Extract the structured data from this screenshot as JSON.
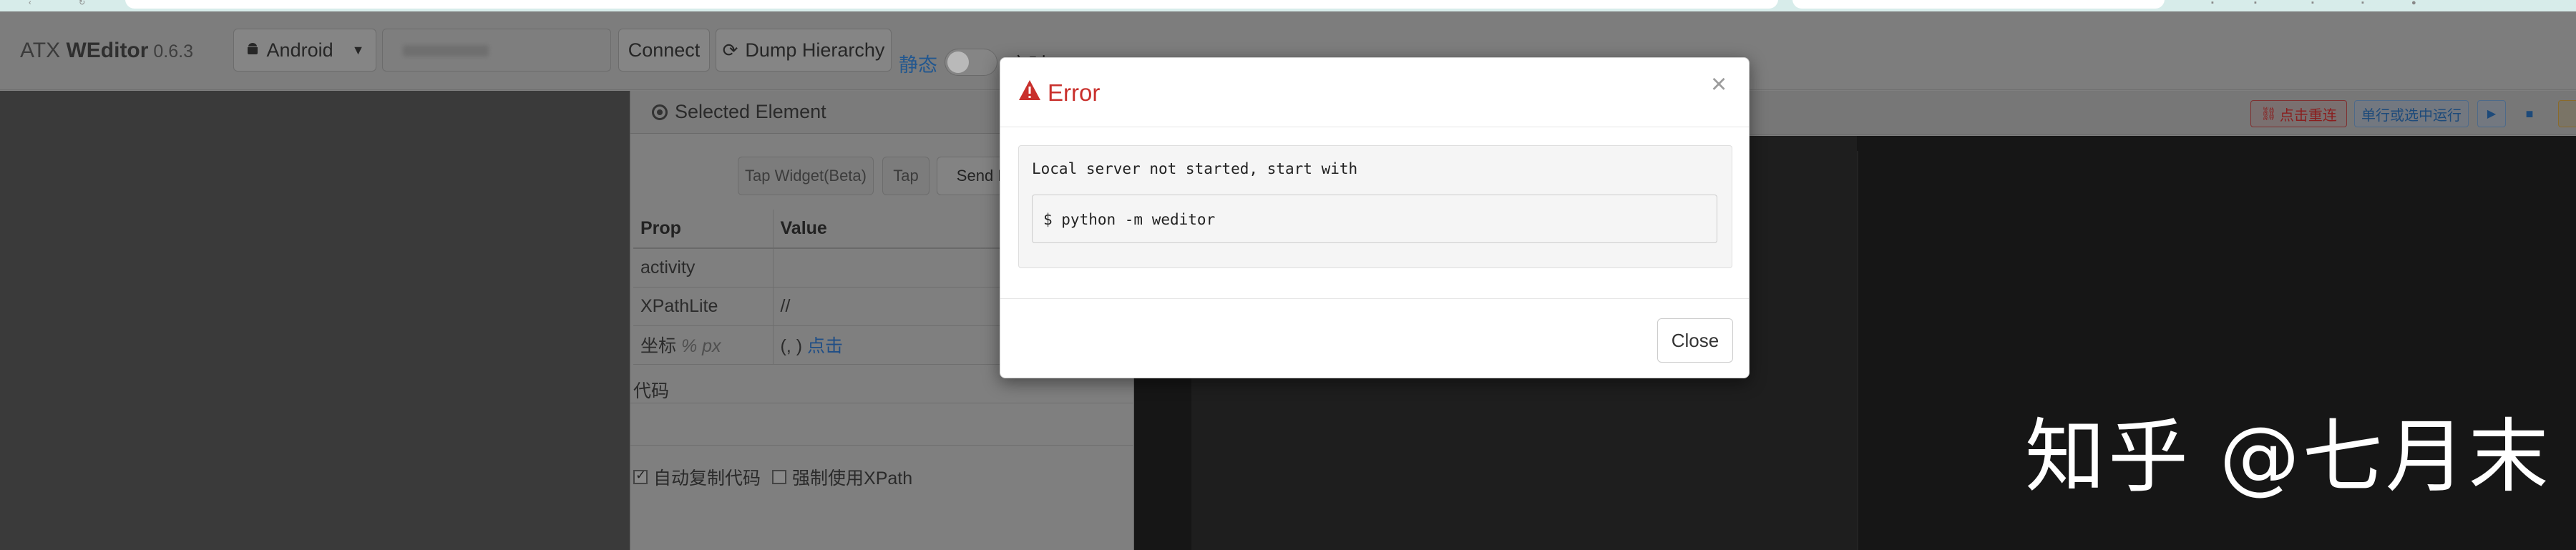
{
  "app": {
    "brand_prefix": "ATX ",
    "brand_name": "WEditor",
    "version": " 0.6.3"
  },
  "navbar": {
    "platform_select": "Android",
    "connect_label": "Connect",
    "dump_label": "Dump Hierarchy",
    "static_label": "静态",
    "realtime_label": "实时"
  },
  "panel": {
    "header_title": "Selected Element",
    "tap_widget_label": "Tap Widget(Beta)",
    "tap_label": "Tap",
    "send_keys_label": "Send Ke",
    "table_headers": [
      "Prop",
      "Value"
    ],
    "rows": [
      {
        "prop": "activity",
        "value": ""
      },
      {
        "prop": "XPathLite",
        "value": "//"
      },
      {
        "prop": "坐标",
        "prop_units": "% px",
        "value": "(, )",
        "value_link": "点击"
      }
    ],
    "code_label": "代码",
    "checkbox_auto_copy": "自动复制代码",
    "checkbox_force_xpath": "强制使用XPath"
  },
  "right_toolbar": {
    "reconnect_label": "点击重连",
    "run_label": "单行或选中运行"
  },
  "modal": {
    "title": "Error",
    "message": "Local server not started, start with",
    "command": "$ python -m weditor",
    "close_label": "Close",
    "close_x": "×"
  },
  "watermark": "知乎 @七月末",
  "colors": {
    "error": "#c9302c",
    "link": "#22578f",
    "overlay_bg": "#7f7f7f"
  }
}
